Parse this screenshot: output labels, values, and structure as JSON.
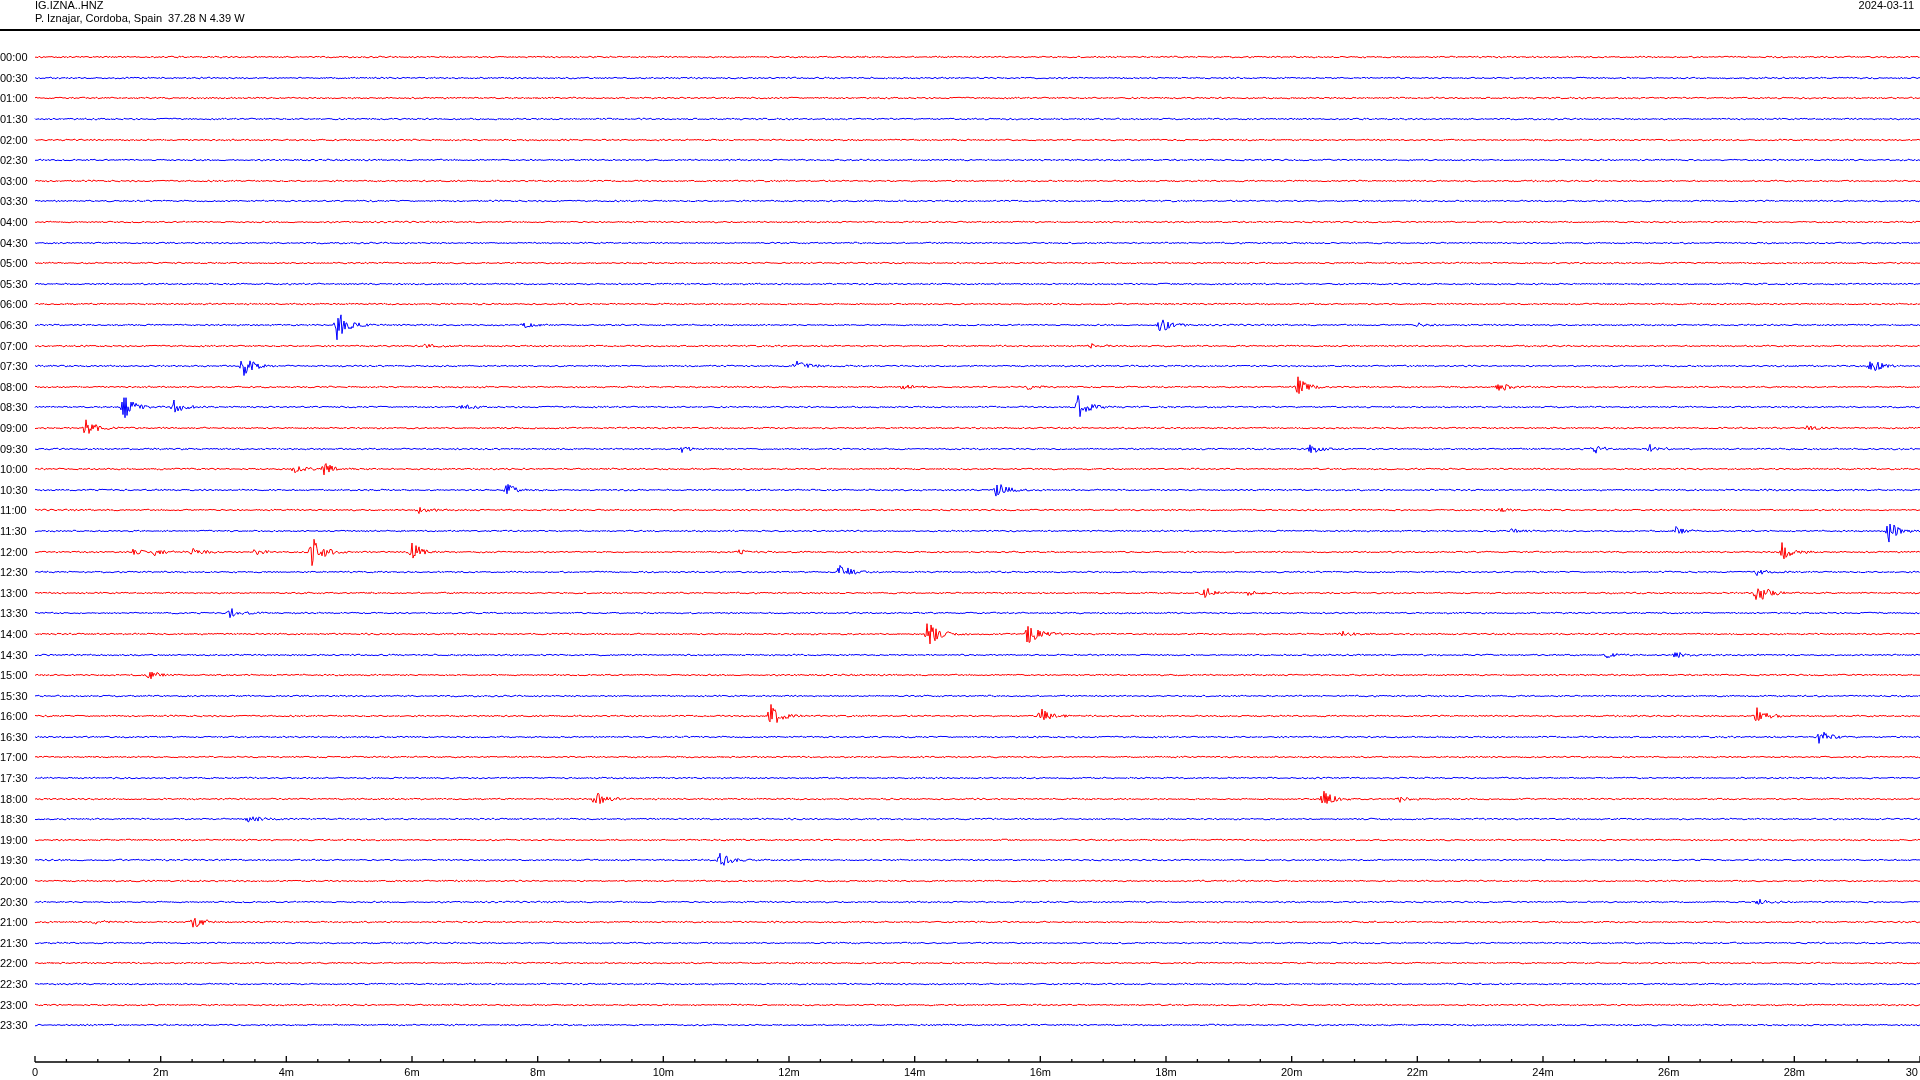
{
  "header": {
    "station": "IG.IZNA..HNZ",
    "location": "P. Iznajar, Cordoba, Spain  37.28 N 4.39 W",
    "date": "2024-03-11"
  },
  "rows": [
    {
      "time": "00:00",
      "color": "#ff0000"
    },
    {
      "time": "00:30",
      "color": "#0000ff"
    },
    {
      "time": "01:00",
      "color": "#ff0000"
    },
    {
      "time": "01:30",
      "color": "#0000ff"
    },
    {
      "time": "02:00",
      "color": "#ff0000"
    },
    {
      "time": "02:30",
      "color": "#0000ff"
    },
    {
      "time": "03:00",
      "color": "#ff0000"
    },
    {
      "time": "03:30",
      "color": "#0000ff"
    },
    {
      "time": "04:00",
      "color": "#ff0000"
    },
    {
      "time": "04:30",
      "color": "#0000ff"
    },
    {
      "time": "05:00",
      "color": "#ff0000"
    },
    {
      "time": "05:30",
      "color": "#0000ff"
    },
    {
      "time": "06:00",
      "color": "#ff0000"
    },
    {
      "time": "06:30",
      "color": "#0000ff"
    },
    {
      "time": "07:00",
      "color": "#ff0000"
    },
    {
      "time": "07:30",
      "color": "#0000ff"
    },
    {
      "time": "08:00",
      "color": "#ff0000"
    },
    {
      "time": "08:30",
      "color": "#0000ff"
    },
    {
      "time": "09:00",
      "color": "#ff0000"
    },
    {
      "time": "09:30",
      "color": "#0000ff"
    },
    {
      "time": "10:00",
      "color": "#ff0000"
    },
    {
      "time": "10:30",
      "color": "#0000ff"
    },
    {
      "time": "11:00",
      "color": "#ff0000"
    },
    {
      "time": "11:30",
      "color": "#0000ff"
    },
    {
      "time": "12:00",
      "color": "#ff0000"
    },
    {
      "time": "12:30",
      "color": "#0000ff"
    },
    {
      "time": "13:00",
      "color": "#ff0000"
    },
    {
      "time": "13:30",
      "color": "#0000ff"
    },
    {
      "time": "14:00",
      "color": "#ff0000"
    },
    {
      "time": "14:30",
      "color": "#0000ff"
    },
    {
      "time": "15:00",
      "color": "#ff0000"
    },
    {
      "time": "15:30",
      "color": "#0000ff"
    },
    {
      "time": "16:00",
      "color": "#ff0000"
    },
    {
      "time": "16:30",
      "color": "#0000ff"
    },
    {
      "time": "17:00",
      "color": "#ff0000"
    },
    {
      "time": "17:30",
      "color": "#0000ff"
    },
    {
      "time": "18:00",
      "color": "#ff0000"
    },
    {
      "time": "18:30",
      "color": "#0000ff"
    },
    {
      "time": "19:00",
      "color": "#ff0000"
    },
    {
      "time": "19:30",
      "color": "#0000ff"
    },
    {
      "time": "20:00",
      "color": "#ff0000"
    },
    {
      "time": "20:30",
      "color": "#0000ff"
    },
    {
      "time": "21:00",
      "color": "#ff0000"
    },
    {
      "time": "21:30",
      "color": "#0000ff"
    },
    {
      "time": "22:00",
      "color": "#ff0000"
    },
    {
      "time": "22:30",
      "color": "#0000ff"
    },
    {
      "time": "23:00",
      "color": "#ff0000"
    },
    {
      "time": "23:30",
      "color": "#0000ff"
    }
  ],
  "x_axis": {
    "tick_labels": [
      "0",
      "2m",
      "4m",
      "6m",
      "8m",
      "10m",
      "12m",
      "14m",
      "16m",
      "18m",
      "20m",
      "22m",
      "24m",
      "26m",
      "28m",
      "30"
    ]
  }
}
